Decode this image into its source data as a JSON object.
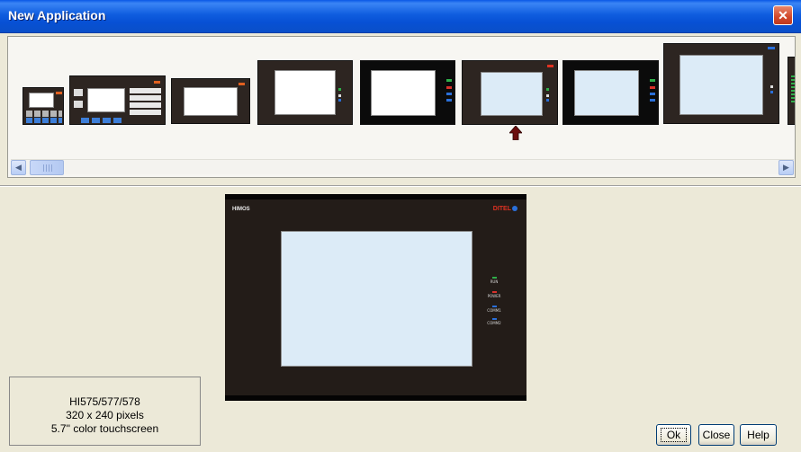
{
  "window": {
    "title": "New Application",
    "close_icon": "close-icon"
  },
  "device_strip": {
    "selected_index": 5,
    "selection_marker_icon": "up-arrow-icon",
    "devices_visible": 9
  },
  "scrollbar": {
    "left_icon": "scroll-left-icon",
    "right_icon": "scroll-right-icon",
    "left_glyph": "◀",
    "right_glyph": "▶"
  },
  "preview": {
    "brand_left": "HIMOS",
    "brand_right": "DITEL",
    "indicators": [
      {
        "label": "RUN",
        "color": "#2fae4a"
      },
      {
        "label": "POWER",
        "color": "#d9312b"
      },
      {
        "label": "COMM1",
        "color": "#2a6fd9"
      },
      {
        "label": "COMM2",
        "color": "#2a6fd9"
      }
    ]
  },
  "info": {
    "model": "HI575/577/578",
    "resolution": "320 x 240 pixels",
    "screen": "5.7'' color touchscreen"
  },
  "buttons": {
    "ok": "Ok",
    "close": "Close",
    "help": "Help"
  },
  "colors": {
    "titlebar": "#0a58e6",
    "dialog_bg": "#ece9d8",
    "device_bezel": "#2d2521",
    "screen_blue": "#dcebf7"
  }
}
